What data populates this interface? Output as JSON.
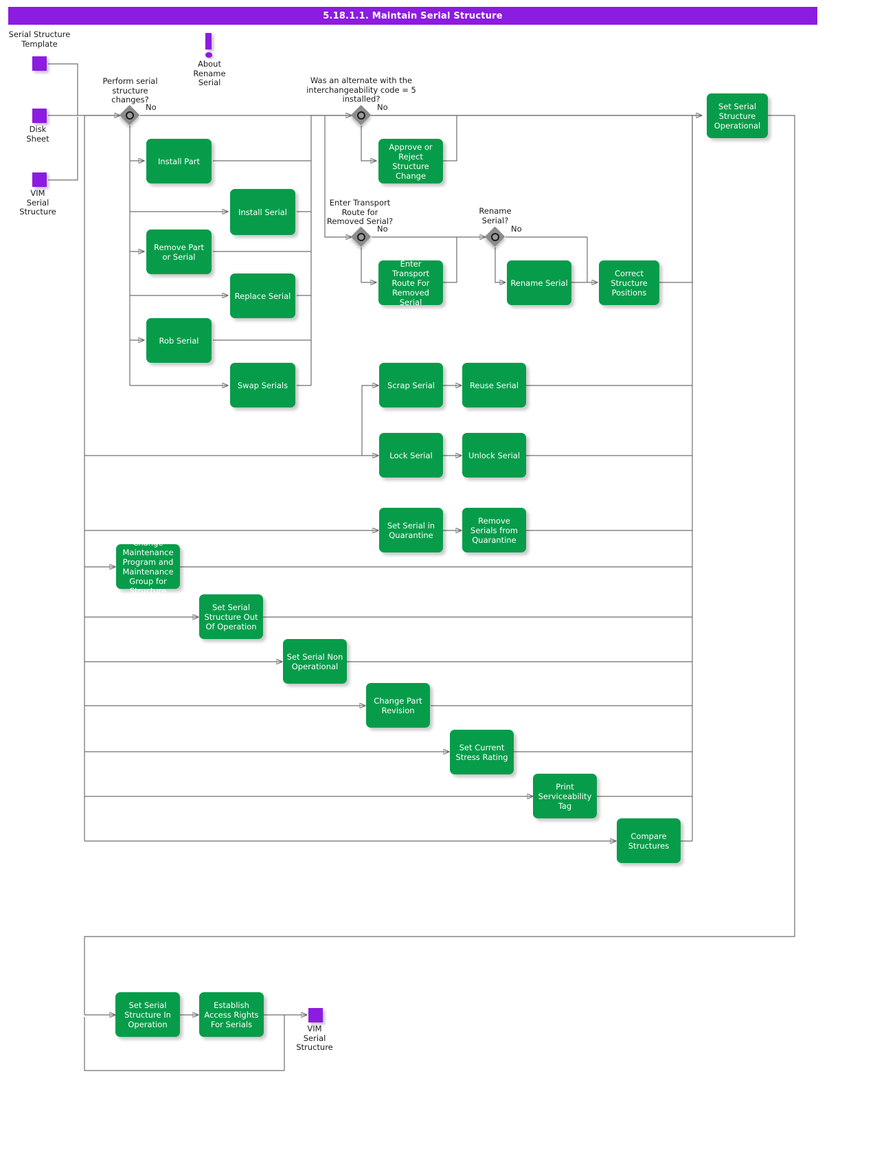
{
  "header": {
    "title": "5.18.1.1. Maintain Serial Structure"
  },
  "data_objects": [
    {
      "name": "serial-structure-template",
      "label": "Serial Structure\nTemplate"
    },
    {
      "name": "disk-sheet",
      "label": "Disk\nSheet"
    },
    {
      "name": "vim-serial-structure-input",
      "label": "VIM\nSerial\nStructure"
    },
    {
      "name": "vim-serial-structure-output",
      "label": "VIM\nSerial\nStructure"
    }
  ],
  "annotations": [
    {
      "name": "about-rename-serial-note",
      "label": "About\nRename\nSerial"
    }
  ],
  "gateways": [
    {
      "name": "perform-serial-structure-changes",
      "question": "Perform serial\nstructure\nchanges?",
      "branch_label": "No"
    },
    {
      "name": "alternate-interchangeability-code-5",
      "question": "Was an alternate with the\ninterchangeability code = 5\ninstalled?",
      "branch_label": "No"
    },
    {
      "name": "enter-transport-route-for-removed-serial",
      "question": "Enter Transport\nRoute for\nRemoved Serial?",
      "branch_label": "No"
    },
    {
      "name": "rename-serial",
      "question": "Rename\nSerial?",
      "branch_label": "No"
    }
  ],
  "activities": [
    {
      "name": "install-part",
      "label": "Install Part"
    },
    {
      "name": "install-serial",
      "label": "Install Serial"
    },
    {
      "name": "remove-part-or-serial",
      "label": "Remove Part or\nSerial"
    },
    {
      "name": "replace-serial",
      "label": "Replace Serial"
    },
    {
      "name": "rob-serial",
      "label": "Rob Serial"
    },
    {
      "name": "swap-serials",
      "label": "Swap Serials"
    },
    {
      "name": "approve-or-reject-structure-change",
      "label": "Approve or\nReject Structure\nChange"
    },
    {
      "name": "enter-transport-route-for-removed-serial",
      "label": "Enter Transport\nRoute For\nRemoved Serial"
    },
    {
      "name": "rename-serial",
      "label": "Rename Serial"
    },
    {
      "name": "correct-structure-positions",
      "label": "Correct\nStructure\nPositions"
    },
    {
      "name": "set-serial-structure-operational",
      "label": "Set Serial\nStructure\nOperational"
    },
    {
      "name": "scrap-serial",
      "label": "Scrap Serial"
    },
    {
      "name": "reuse-serial",
      "label": "Reuse Serial"
    },
    {
      "name": "lock-serial",
      "label": "Lock Serial"
    },
    {
      "name": "unlock-serial",
      "label": "Unlock Serial"
    },
    {
      "name": "set-serial-in-quarantine",
      "label": "Set Serial in\nQuarantine"
    },
    {
      "name": "remove-serials-from-quarantine",
      "label": "Remove Serials\nfrom Quarantine"
    },
    {
      "name": "change-maintenance-program-and-maintenance-group-for-structure",
      "label": "Change\nMaintenance\nProgram and\nMaintenance\nGroup for\nStructure"
    },
    {
      "name": "set-serial-structure-out-of-operation",
      "label": "Set Serial\nStructure Out Of\nOperation"
    },
    {
      "name": "set-serial-non-operational",
      "label": "Set Serial\nNon\nOperational"
    },
    {
      "name": "change-part-revision",
      "label": "Change Part\nRevision"
    },
    {
      "name": "set-current-stress-rating",
      "label": "Set Current\nStress Rating"
    },
    {
      "name": "print-serviceability-tag",
      "label": "Print\nServiceability\nTag"
    },
    {
      "name": "compare-structures",
      "label": "Compare\nStructures"
    },
    {
      "name": "set-serial-structure-in-operation",
      "label": "Set Serial\nStructure In\nOperation"
    },
    {
      "name": "establish-access-rights-for-serials",
      "label": "Establish Access\nRights For\nSerials"
    }
  ],
  "colors": {
    "title_bar": "#8b1ce0",
    "activity": "#079c4a",
    "data_object": "#8b1ce0",
    "gateway": "#8c8c8c",
    "connector": "#6f6f6f"
  }
}
